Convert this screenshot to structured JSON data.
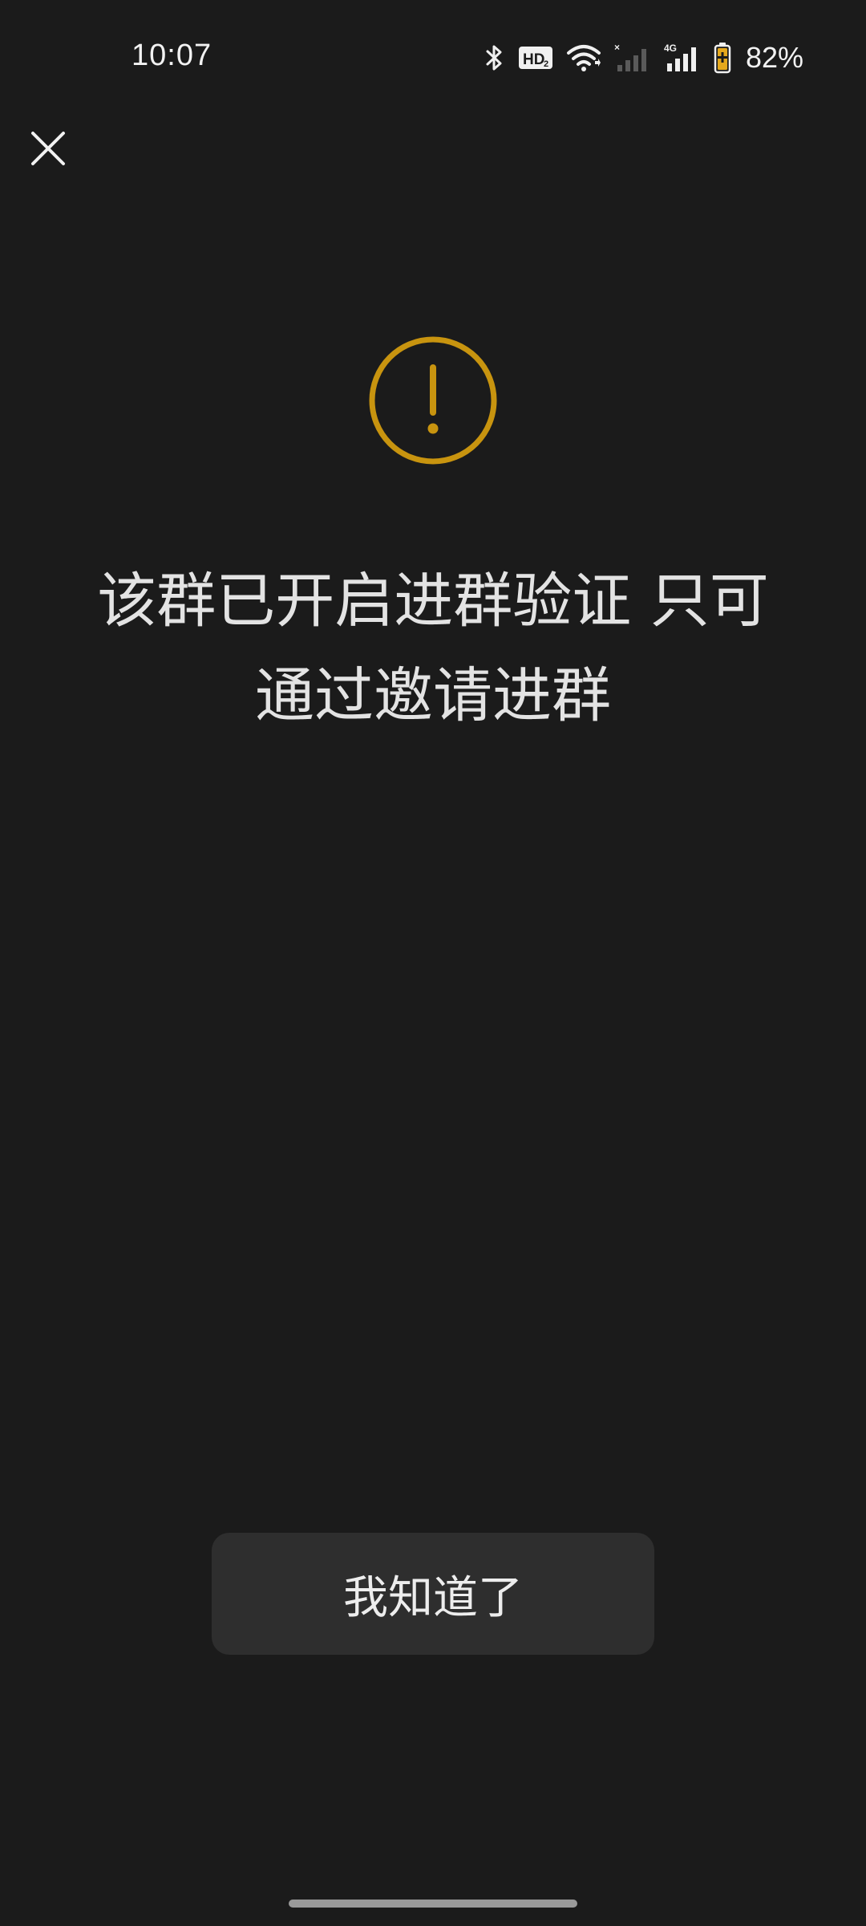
{
  "status_bar": {
    "time": "10:07",
    "battery_percent": "82%",
    "icons": [
      "bluetooth-icon",
      "hd-voice-icon",
      "wifi-icon",
      "signal-sim1-no-service-icon",
      "signal-4g-icon",
      "battery-charging-icon"
    ],
    "hd_label": "HD",
    "hd_sub": "2",
    "network_label": "4G"
  },
  "dialog": {
    "close_icon": "close-icon",
    "warning_icon": "exclamation-circle-icon",
    "message_line1": "该群已开启进群验证 只可",
    "message_line2": "通过邀请进群",
    "confirm_label": "我知道了"
  },
  "colors": {
    "background": "#1b1b1b",
    "accent_warning": "#c8940f",
    "button_bg": "#2e2e2e",
    "text": "#e3e3e3",
    "battery_accent": "#e5a81c"
  }
}
